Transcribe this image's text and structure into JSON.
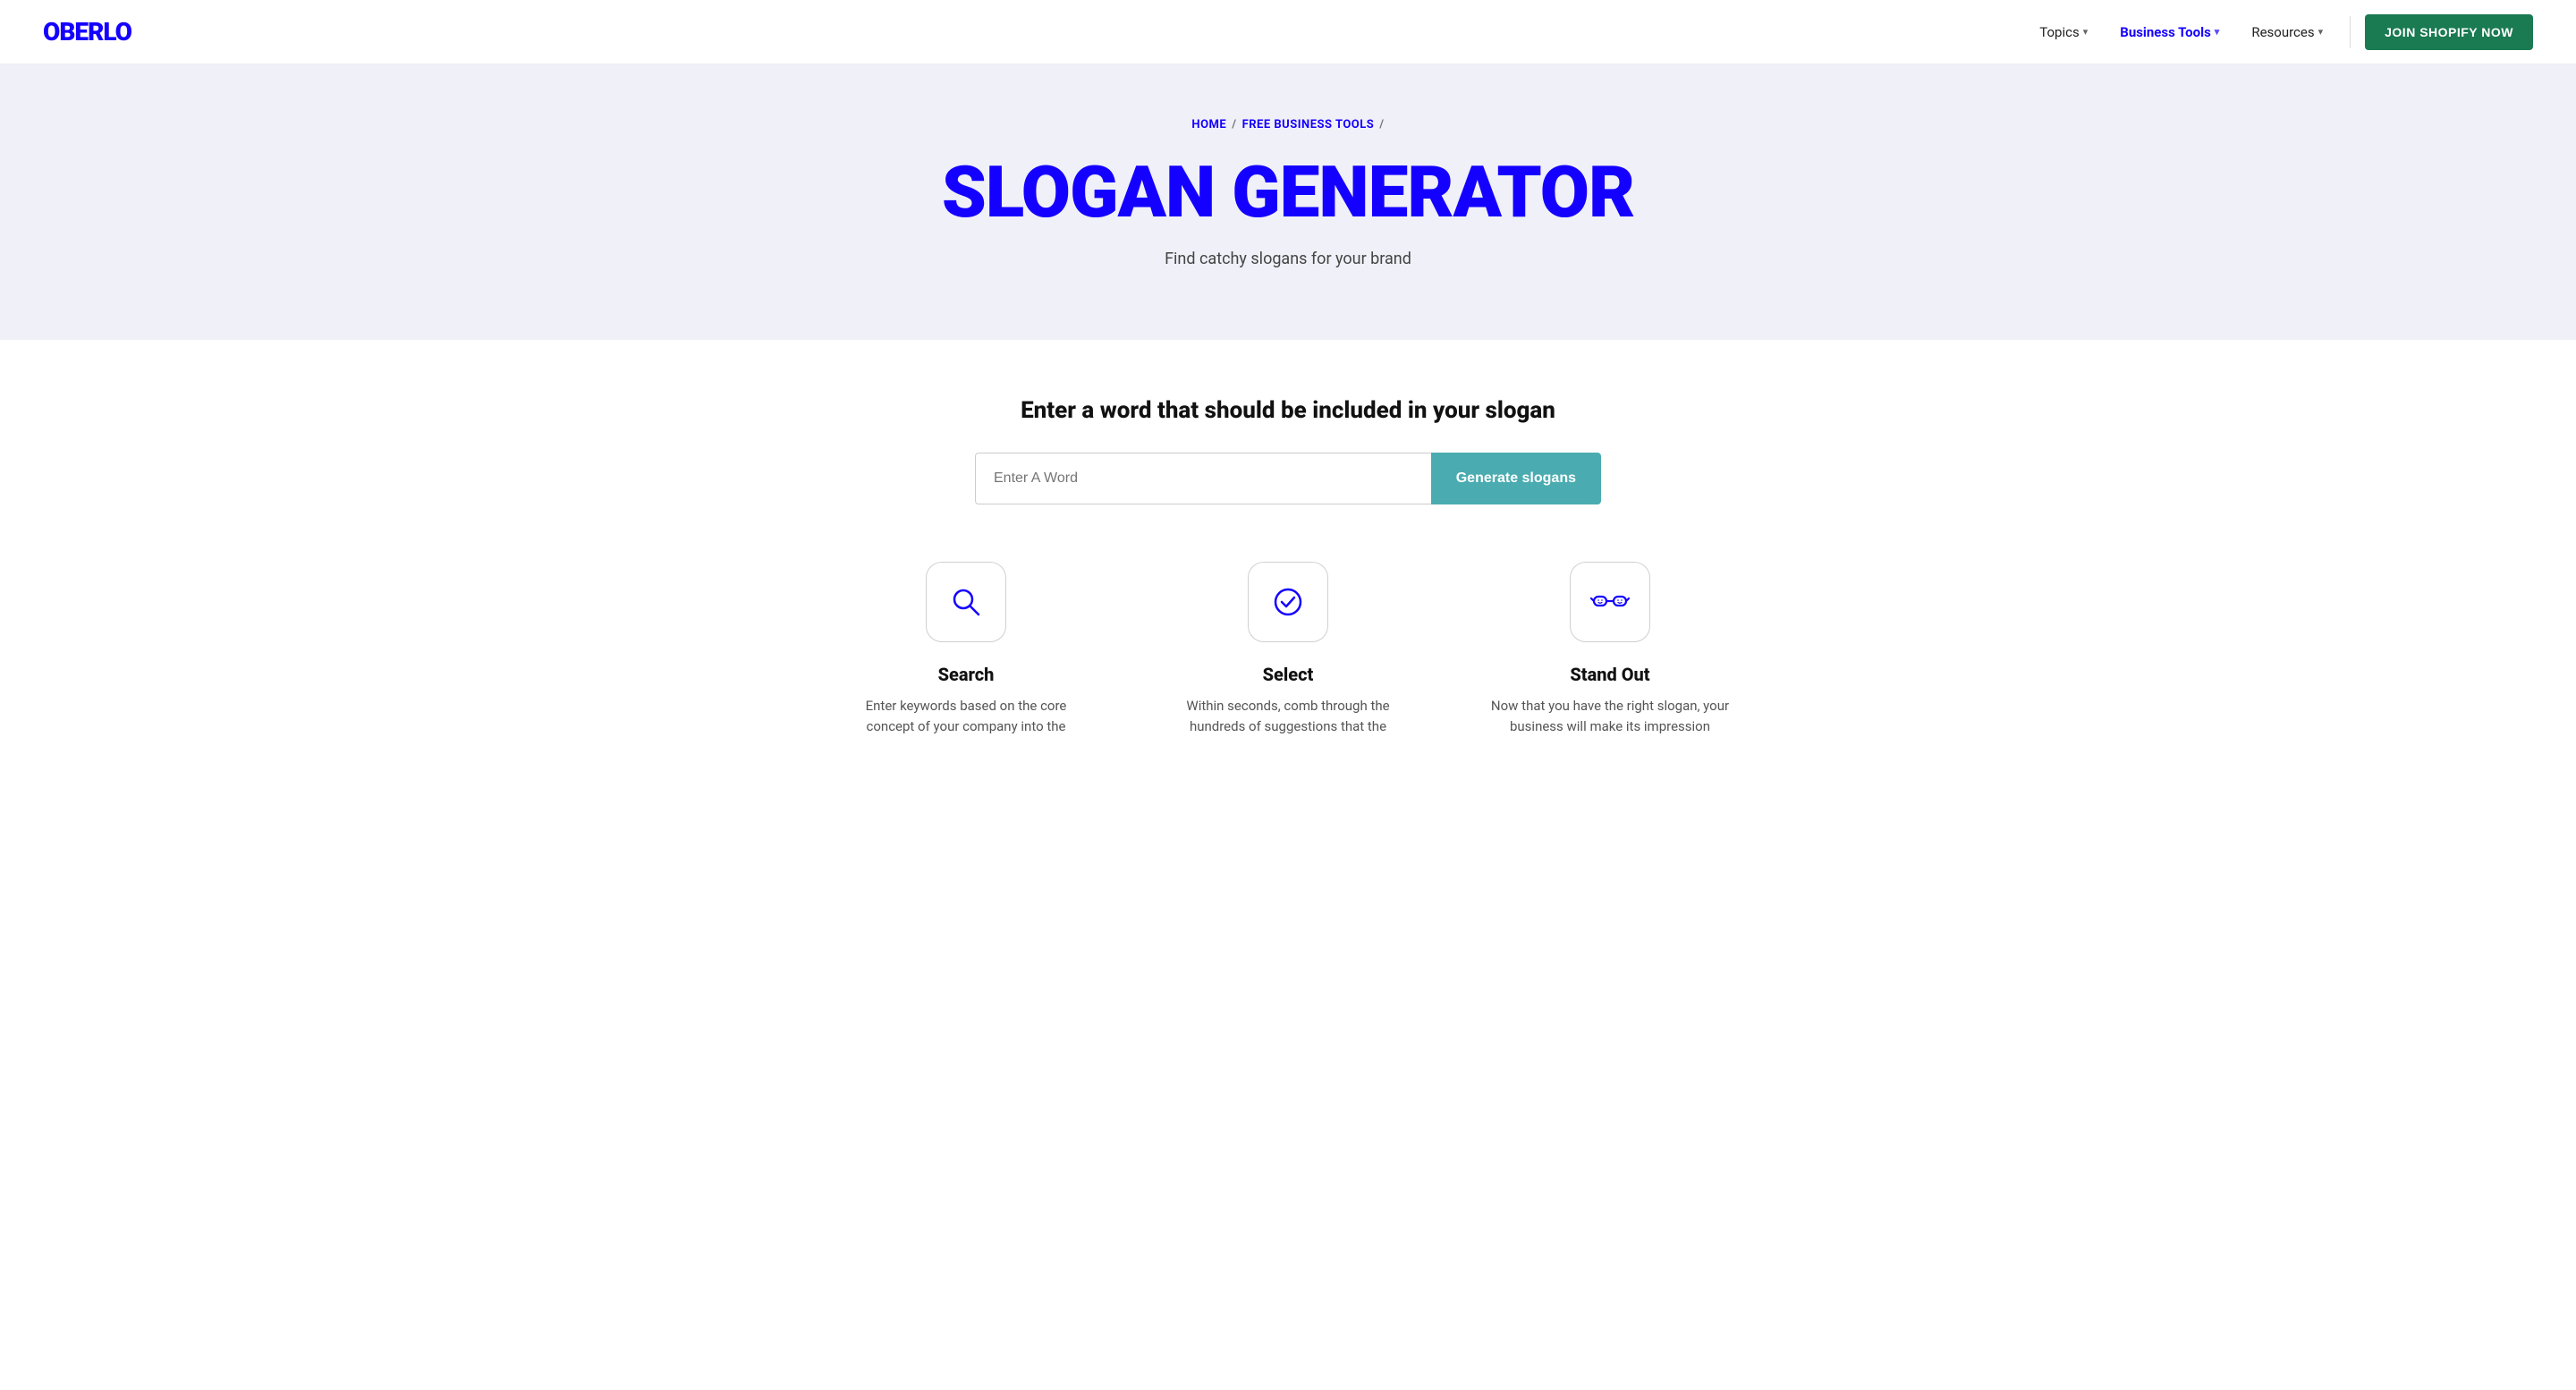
{
  "brand": {
    "logo": "OBERLO"
  },
  "nav": {
    "items": [
      {
        "label": "Topics",
        "active": false,
        "has_chevron": true
      },
      {
        "label": "Business Tools",
        "active": true,
        "has_chevron": true
      },
      {
        "label": "Resources",
        "active": false,
        "has_chevron": true
      }
    ],
    "cta_label": "JOIN SHOPIFY NOW"
  },
  "breadcrumb": {
    "home": "HOME",
    "section": "FREE BUSINESS TOOLS",
    "separator": "/"
  },
  "hero": {
    "title": "SLOGAN GENERATOR",
    "subtitle": "Find catchy slogans for your brand"
  },
  "generator": {
    "heading": "Enter a word that should be included in your slogan",
    "input_placeholder": "Enter A Word",
    "button_label": "Generate slogans"
  },
  "features": [
    {
      "id": "search",
      "title": "Search",
      "desc": "Enter keywords based on the core concept of your company into the"
    },
    {
      "id": "select",
      "title": "Select",
      "desc": "Within seconds, comb through the hundreds of suggestions that the"
    },
    {
      "id": "standout",
      "title": "Stand Out",
      "desc": "Now that you have the right slogan, your business will make its impression"
    }
  ]
}
